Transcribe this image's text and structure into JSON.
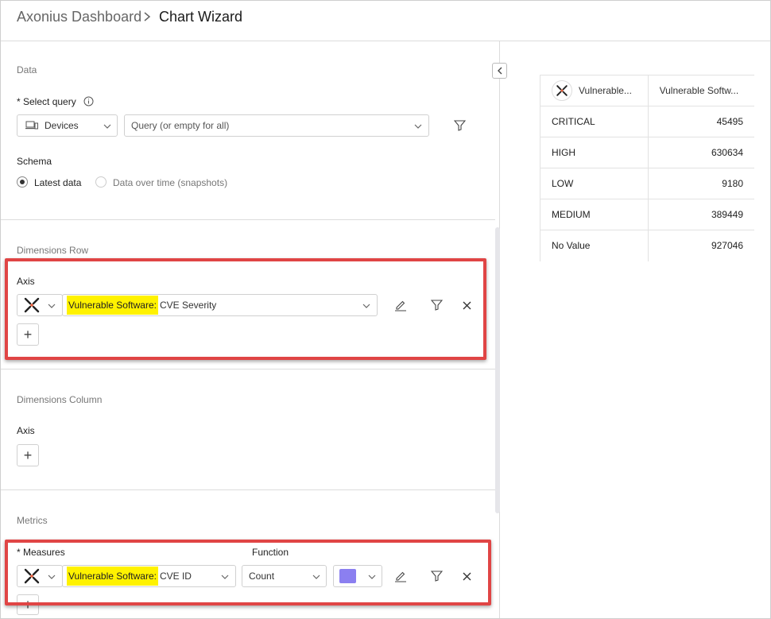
{
  "breadcrumb": {
    "parent": "Axonius Dashboard",
    "current": "Chart Wizard"
  },
  "data_section": {
    "title": "Data",
    "select_query_label": "* Select query",
    "entity": "Devices",
    "query_placeholder": "Query (or empty for all)",
    "schema_label": "Schema",
    "schema_options": [
      "Latest data",
      "Data over time (snapshots)"
    ],
    "schema_selected": "Latest data"
  },
  "dimensions_row": {
    "title": "Dimensions Row",
    "axis_label": "Axis",
    "field_prefix": "Vulnerable Software:",
    "field_name": "CVE Severity",
    "add_label": "+"
  },
  "dimensions_column": {
    "title": "Dimensions Column",
    "axis_label": "Axis",
    "add_label": "+"
  },
  "metrics": {
    "title": "Metrics",
    "measures_label": "* Measures",
    "function_label": "Function",
    "field_prefix": "Vulnerable Software:",
    "field_name": "CVE ID",
    "function_value": "Count",
    "color": "#8b7ff0",
    "add_label": "+"
  },
  "icons": {
    "breadcrumb_sep": "chevron-right-icon",
    "collapse": "chevron-left-icon",
    "info": "info-icon",
    "devices": "devices-icon",
    "filter": "filter-icon",
    "edit": "pencil-icon",
    "remove": "close-icon",
    "adapter": "axonius-adapter-icon"
  },
  "preview_table": {
    "headers": [
      "Vulnerable...",
      "Vulnerable Softw..."
    ],
    "rows": [
      [
        "CRITICAL",
        "45495"
      ],
      [
        "HIGH",
        "630634"
      ],
      [
        "LOW",
        "9180"
      ],
      [
        "MEDIUM",
        "389449"
      ],
      [
        "No Value",
        "927046"
      ]
    ]
  },
  "colors": {
    "highlight": "#fff200",
    "annotation_box": "#e04545"
  }
}
